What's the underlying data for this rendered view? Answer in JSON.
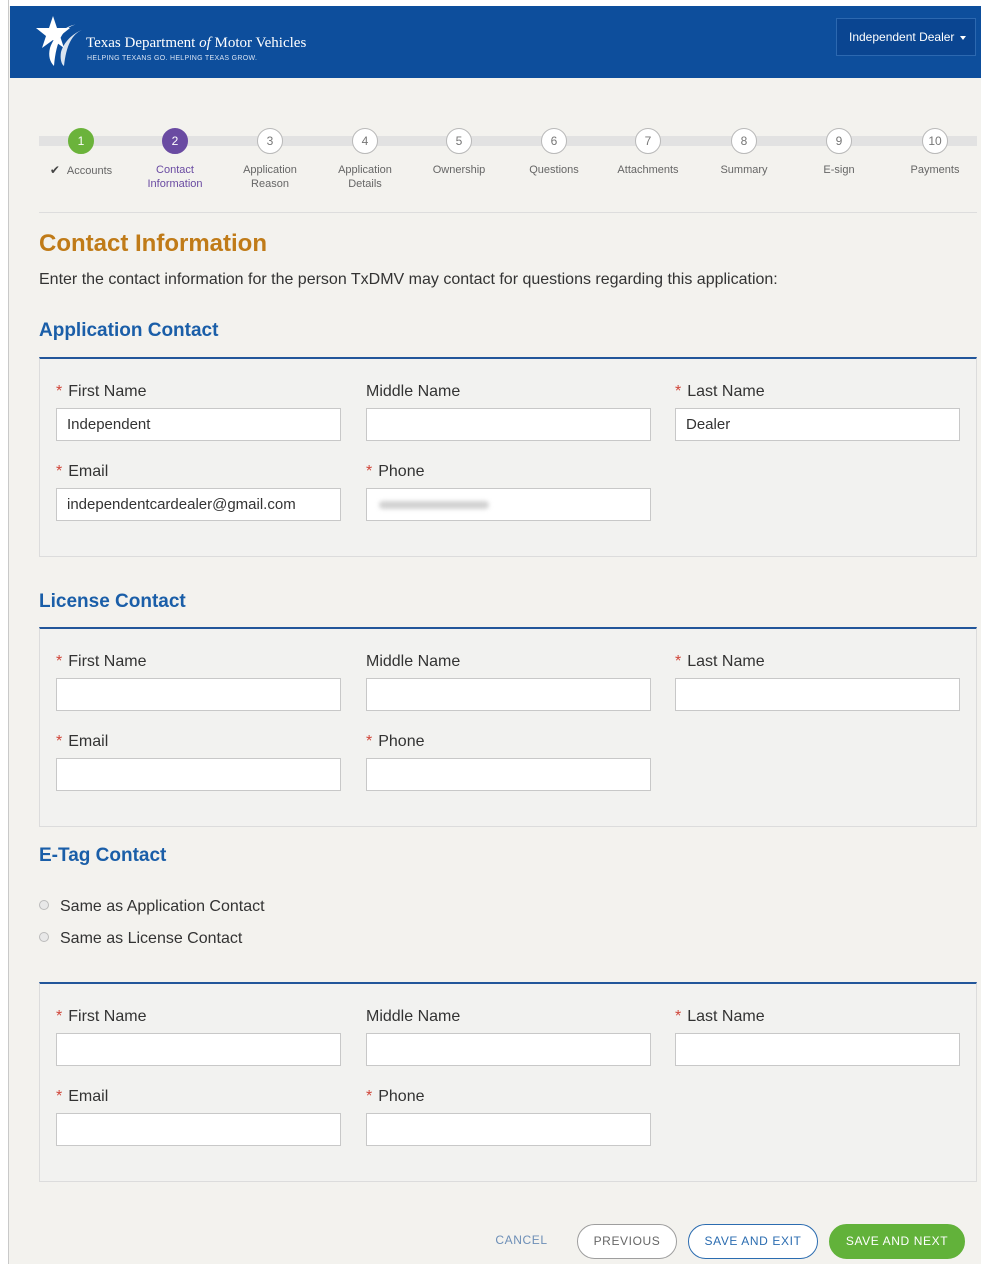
{
  "header": {
    "title_pre": "Texas Department ",
    "title_of": "of",
    "title_post": " Motor Vehicles",
    "tagline": "HELPING TEXANS GO. HELPING TEXAS GROW.",
    "user_menu": "Independent Dealer",
    "logo_icon": "texas-star-logo-icon",
    "brand_color": "#0d4e9c"
  },
  "steps": [
    {
      "num": "1",
      "label": "Accounts",
      "state": "done"
    },
    {
      "num": "2",
      "label": "Contact Information",
      "state": "active"
    },
    {
      "num": "3",
      "label": "Application Reason",
      "state": "todo"
    },
    {
      "num": "4",
      "label": "Application Details",
      "state": "todo"
    },
    {
      "num": "5",
      "label": "Ownership",
      "state": "todo"
    },
    {
      "num": "6",
      "label": "Questions",
      "state": "todo"
    },
    {
      "num": "7",
      "label": "Attachments",
      "state": "todo"
    },
    {
      "num": "8",
      "label": "Summary",
      "state": "todo"
    },
    {
      "num": "9",
      "label": "E-sign",
      "state": "todo"
    },
    {
      "num": "10",
      "label": "Payments",
      "state": "todo"
    }
  ],
  "page": {
    "title": "Contact Information",
    "intro": "Enter the contact information for the person TxDMV may contact for questions regarding this application:"
  },
  "fields": {
    "first_name": "First Name",
    "middle_name": "Middle Name",
    "last_name": "Last Name",
    "email": "Email",
    "phone": "Phone",
    "required_mark": "*"
  },
  "application_contact": {
    "title": "Application Contact",
    "first_name": "Independent",
    "middle_name": "",
    "last_name": "Dealer",
    "email": "independentcardealer@gmail.com",
    "phone": ""
  },
  "license_contact": {
    "title": "License Contact",
    "first_name": "",
    "middle_name": "",
    "last_name": "",
    "email": "",
    "phone": ""
  },
  "etag_contact": {
    "title": "E-Tag Contact",
    "option_application": "Same as Application Contact",
    "option_license": "Same as License Contact",
    "first_name": "",
    "middle_name": "",
    "last_name": "",
    "email": "",
    "phone": ""
  },
  "actions": {
    "cancel": "CANCEL",
    "previous": "PREVIOUS",
    "save_exit": "SAVE AND EXIT",
    "save_next": "SAVE AND NEXT"
  },
  "colors": {
    "step_done": "#6bb33b",
    "step_active": "#6a4ba2",
    "title": "#c07b18",
    "section": "#1a5ea8",
    "required": "#d0463a"
  }
}
